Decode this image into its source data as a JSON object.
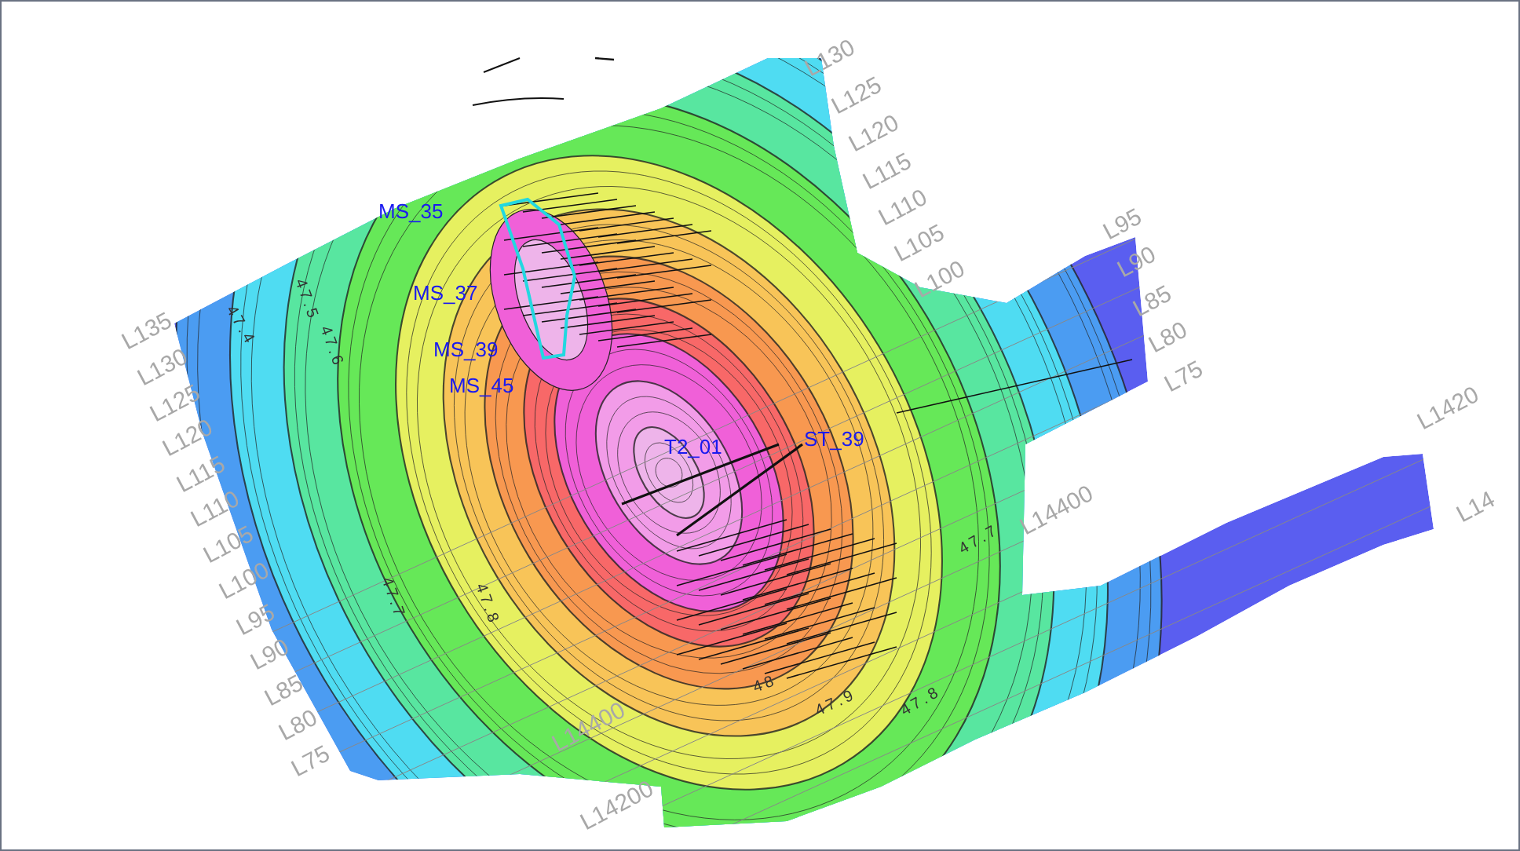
{
  "map": {
    "grid_labels": [
      "L130",
      "L125",
      "L120",
      "L115",
      "L110",
      "L105",
      "L100",
      "L95",
      "L90",
      "L85",
      "L80",
      "L75",
      "L1420",
      "L14",
      "L14400",
      "L135",
      "L130",
      "L125",
      "L120",
      "L115",
      "L110",
      "L105",
      "L100",
      "L95",
      "L90",
      "L85",
      "L80",
      "L75",
      "L14400",
      "L14200"
    ],
    "contour_labels": [
      "47.4",
      "47.5",
      "47.6",
      "47.7",
      "47.8",
      "47.7",
      "48",
      "47.9",
      "47.8"
    ],
    "well_labels": [
      "MS_35",
      "MS_37",
      "MS_39",
      "MS_45",
      "T2_01",
      "ST_39"
    ]
  }
}
